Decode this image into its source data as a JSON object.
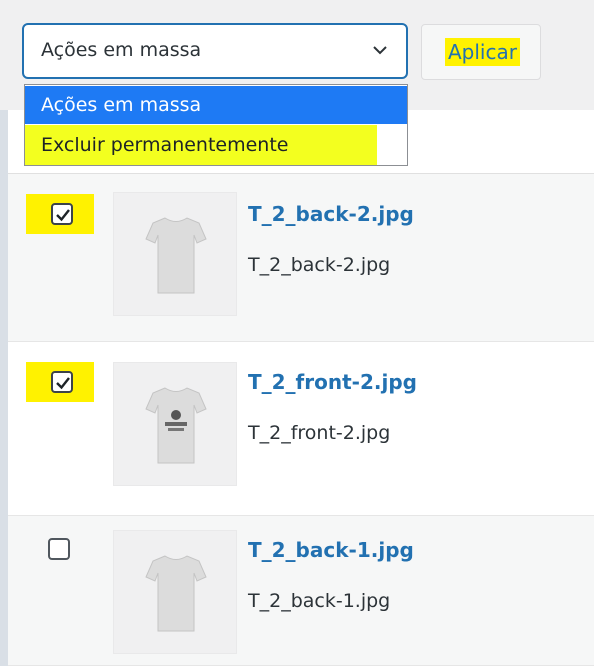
{
  "bulk_actions": {
    "selected_label": "Ações em massa",
    "options": [
      "Ações em massa",
      "Excluir permanentemente"
    ],
    "apply_label": "Aplicar"
  },
  "media": [
    {
      "title": "T_2_back-2.jpg",
      "filename": "T_2_back-2.jpg",
      "checked": true,
      "print": false
    },
    {
      "title": "T_2_front-2.jpg",
      "filename": "T_2_front-2.jpg",
      "checked": true,
      "print": true
    },
    {
      "title": "T_2_back-1.jpg",
      "filename": "T_2_back-1.jpg",
      "checked": false,
      "print": false
    }
  ],
  "colors": {
    "accent": "#2271b1",
    "highlight": "#fff200",
    "dropdown_selected": "#1e7af4"
  },
  "icons": {
    "dropdown": "chevron-down-icon",
    "checkbox": "checkmark-icon",
    "thumbnail": "tshirt-icon"
  }
}
